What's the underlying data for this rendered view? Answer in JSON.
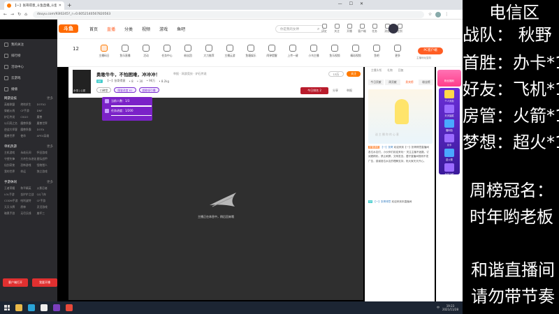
{
  "browser": {
    "tab_title": "【一】张哥得意_斗鱼直播_斗鱼",
    "url": "douyu.com/93l0245?_r=0.6052140567820563",
    "new_tab": "+",
    "min_icon": "—",
    "max_icon": "☐",
    "close_icon": "✕",
    "nav_back": "←",
    "nav_fwd": "→",
    "nav_reload": "↻",
    "nav_home": "⌂",
    "star_icon": "☆",
    "menu_icon": "⋮"
  },
  "site": {
    "logo": "斗鱼",
    "nav": [
      "首页",
      "直播",
      "分类",
      "视频",
      "游戏",
      "鱼吧"
    ],
    "nav_active_index": 1,
    "search_placeholder": "你是我的女神",
    "header_icons": [
      "历史",
      "关注",
      "开播",
      "客户端",
      "任务",
      "消息",
      "签到"
    ]
  },
  "sidebar": {
    "top_items": [
      "我的关注",
      "排行榜",
      "活动中心",
      "云游戏",
      "播播"
    ],
    "sections": [
      {
        "title": "网游竞技",
        "more": "更多",
        "items": [
          "英雄联盟",
          "绝地求生",
          "DOTA2",
          "穿越火线",
          "CF手游",
          "DNF",
          "炉石传说",
          "CSGO",
          "魔兽",
          "以闪亮之名",
          "魔兽争霸",
          "魔兽世界",
          "逆战大师客",
          "魔兽争霸",
          "DOTA",
          "魔兽世界",
          "使命",
          "APEX英雄"
        ]
      },
      {
        "title": "单机热游",
        "more": "更多",
        "items": [
          "主机游戏",
          "永劫无间",
          "怀旧游戏",
          "守望先锋",
          "方舟生存进化",
          "星际战甲",
          "仙剑奇侠",
          "恐怖游戏",
          "怪物猎人",
          "我的世界",
          "命运",
          "独立游戏"
        ]
      },
      {
        "title": "手游休闲",
        "more": "更多",
        "items": [
          "王者荣耀",
          "和平精英",
          "火影忍者",
          "LOL手游",
          "金铲铲之战",
          "QQ飞车",
          "CODM手游",
          "哈利波特",
          "CF手游",
          "天天卡牌",
          "原神",
          "灵活游戏",
          "暗黑手游",
          "无尽兵线",
          "崩坏三"
        ]
      }
    ],
    "btn_client": "客户端打开",
    "btn_broadcast": "我要开播"
  },
  "categories": {
    "count": "12",
    "count_label": "主播码日",
    "badge": "1",
    "items": [
      "主播码日",
      "鱼乐直播",
      "活动",
      "任务中心",
      "粉丝团",
      "大力推荐",
      "主播云游",
      "鱼塘娱乐",
      "闹钟提醒",
      "上传一键",
      "小鸟主播",
      "鱼乐视频",
      "精彩视频",
      "鱼吧",
      "更多"
    ],
    "pc_live": "PC客户端",
    "pc_sub": "主播地址复制"
  },
  "room": {
    "title": "勇敢牛牛，不怕困难，冲冲冲！",
    "meta": "举报 · 网游竞技 · 炉石传说",
    "level": "LV",
    "line2": [
      "【一】张哥得意",
      "• 8",
      "• 30",
      "• 96万",
      "• 8.2kg"
    ],
    "avatar_caption": "永恒 | 心愿",
    "tags": [
      "口碑堂",
      "图鉴进度 81",
      "超能吸引播"
    ],
    "follow_count": "13万",
    "follow": "关注",
    "rank_btn": "今日排名 2",
    "share": "分享",
    "report": "举报"
  },
  "popup": {
    "row1": "当前人数：1/3",
    "row2": "任务进度：1/200"
  },
  "player": {
    "load_text": "主播正在休息中，稍后回来哦"
  },
  "chat": {
    "top": [
      "主播头衔",
      "礼物",
      "回复",
      "排行"
    ],
    "tabs": [
      "今日贡献",
      "周贡献",
      "贵宾榜",
      "粉丝榜"
    ],
    "banner_text": "送 主 播 你 的 心 意",
    "msgs": [
      {
        "badge": "房管通知",
        "name": "【一】张哥",
        "text": "欢迎来到【一】张哥得意直播间 各位水友们，小伙伴们欢迎来玩~ 关注主播不迷路，订阅更精彩。禁止刷屏，文明发言。遵守直播间规则不发广告，感谢各位水友的理解支持，祝大家天天开心。"
      },
      {
        "badge": "LV",
        "name": "【一】张哥得意",
        "text": "欢迎来到本直播间"
      }
    ]
  },
  "giftbar": {
    "top": "粉丝福利",
    "items": [
      "个人头衔",
      "天天抽奖",
      "福利包",
      "月卡",
      "送火箭",
      "全站飞船"
    ]
  },
  "overlay": {
    "title": "电信区",
    "team": "战队：  秋野",
    "first_win": "首胜：办卡*1",
    "friend": "好友：飞机*1",
    "room_mgr": "房管：火箭*1",
    "dream": "梦想：超火*1",
    "weekly": "周榜冠名：",
    "weekly_name": "时年哟老板",
    "notice1": "和谐直播间",
    "notice2": "请勿带节奏"
  },
  "taskbar": {
    "time": "19:23",
    "date": "2021/11/28",
    "lang": "中"
  },
  "colors": {
    "brand": "#ff5d23",
    "popup_purple": "#7b22c8",
    "sidebar_bg": "#2a2a2e",
    "player_bg": "#2f2f2f"
  }
}
